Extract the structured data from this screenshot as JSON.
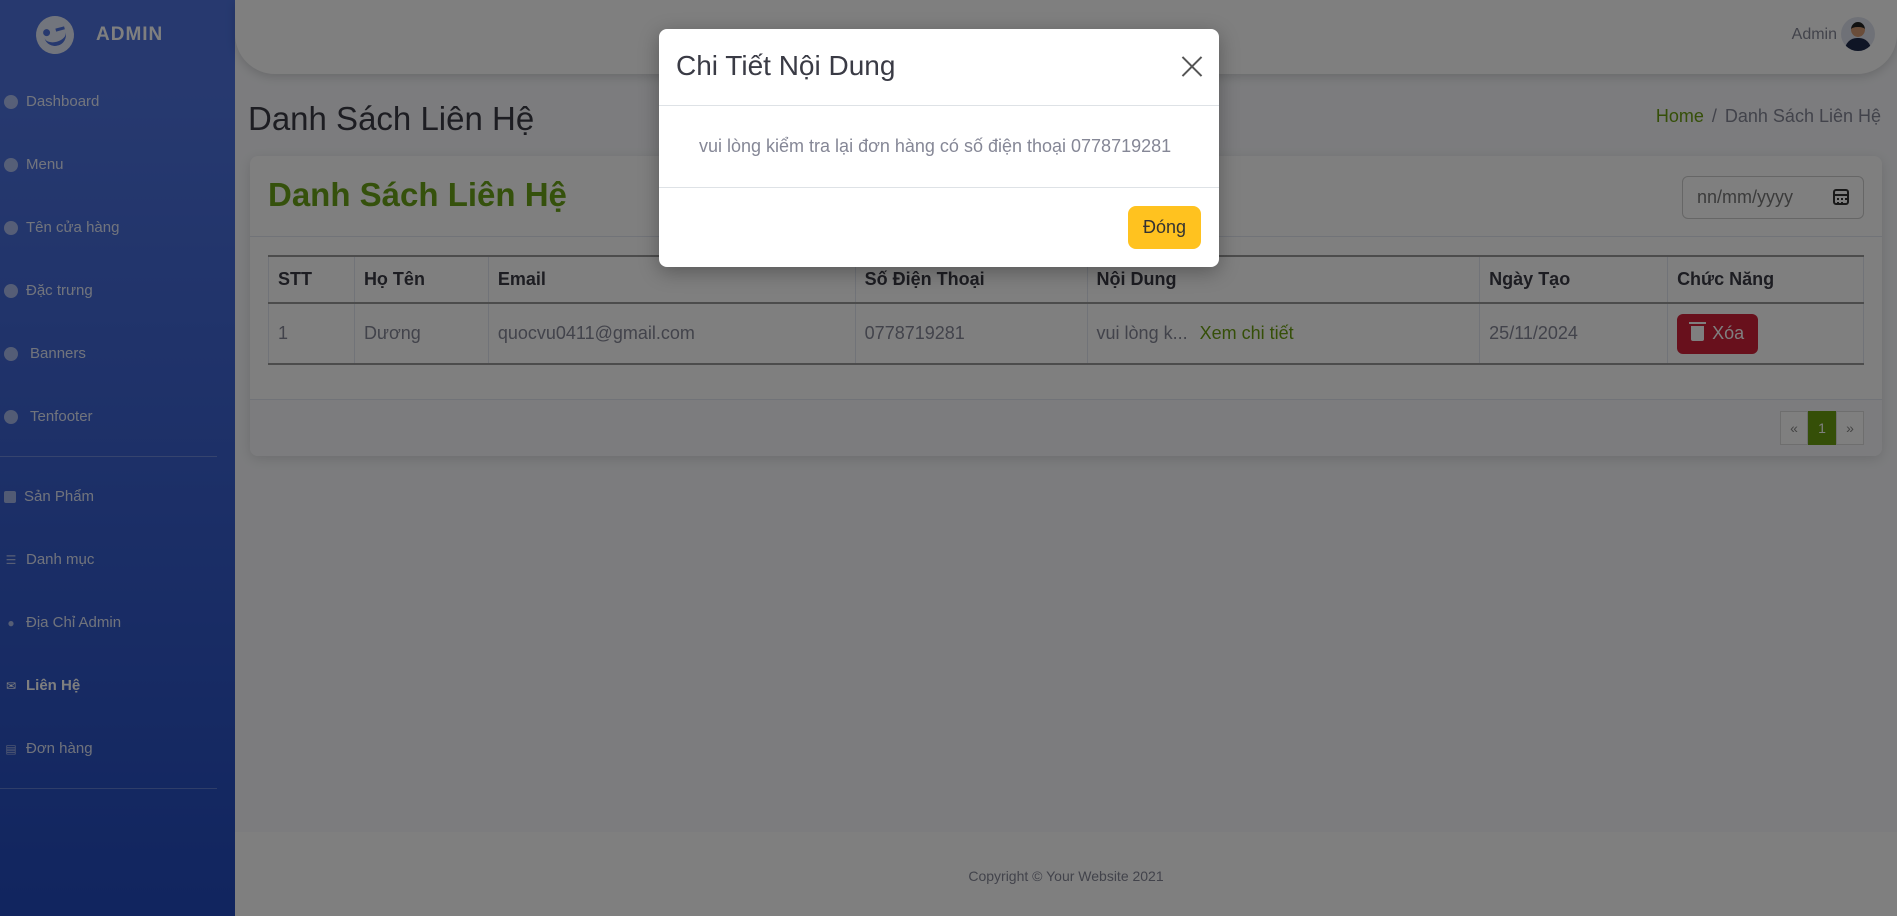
{
  "sidebar": {
    "brand": "ADMIN",
    "items": [
      {
        "label": "Dashboard",
        "icon": "circle-icon"
      },
      {
        "label": "Menu",
        "icon": "circle-icon"
      },
      {
        "label": "Tên cửa hàng",
        "icon": "circle-icon"
      },
      {
        "label": "Đặc trưng",
        "icon": "circle-icon"
      },
      {
        "label": "Banners",
        "icon": "circle-icon"
      },
      {
        "label": "Tenfooter",
        "icon": "circle-icon"
      },
      {
        "label": "Sản Phẩm",
        "icon": "box-icon"
      },
      {
        "label": "Danh mục",
        "icon": "list-icon"
      },
      {
        "label": "Địa Chỉ Admin",
        "icon": "map-marker-icon"
      },
      {
        "label": "Liên Hệ",
        "icon": "envelope-icon"
      },
      {
        "label": "Đơn hàng",
        "icon": "receipt-icon"
      }
    ]
  },
  "topbar": {
    "user_name": "Admin"
  },
  "page": {
    "title": "Danh Sách Liên Hệ"
  },
  "breadcrumb": {
    "home": "Home",
    "sep": "/",
    "current": "Danh Sách Liên Hệ"
  },
  "card": {
    "title": "Danh Sách Liên Hệ",
    "date_placeholder": "nn/mm/yyyy"
  },
  "table": {
    "headers": [
      "STT",
      "Họ Tên",
      "Email",
      "Số Điện Thoại",
      "Nội Dung",
      "Ngày Tạo",
      "Chức Năng"
    ],
    "rows": [
      {
        "stt": "1",
        "name": "Dương",
        "email": "quocvu0411@gmail.com",
        "phone": "0778719281",
        "content": "vui lòng k...",
        "detail_link": "Xem chi tiết",
        "date": "25/11/2024",
        "delete_label": "Xóa"
      }
    ]
  },
  "pagination": {
    "prev": "«",
    "current": "1",
    "next": "»"
  },
  "footer": {
    "copyright": "Copyright © Your Website 2021"
  },
  "modal": {
    "title": "Chi Tiết Nội Dung",
    "body": "vui lòng kiểm tra lại đơn hàng có số điện thoại 0778719281",
    "close_label": "Đóng"
  },
  "colors": {
    "accent": "#6aa319",
    "sidebar": "#4e73df",
    "danger": "#d02038",
    "warning": "#ffc21f"
  }
}
